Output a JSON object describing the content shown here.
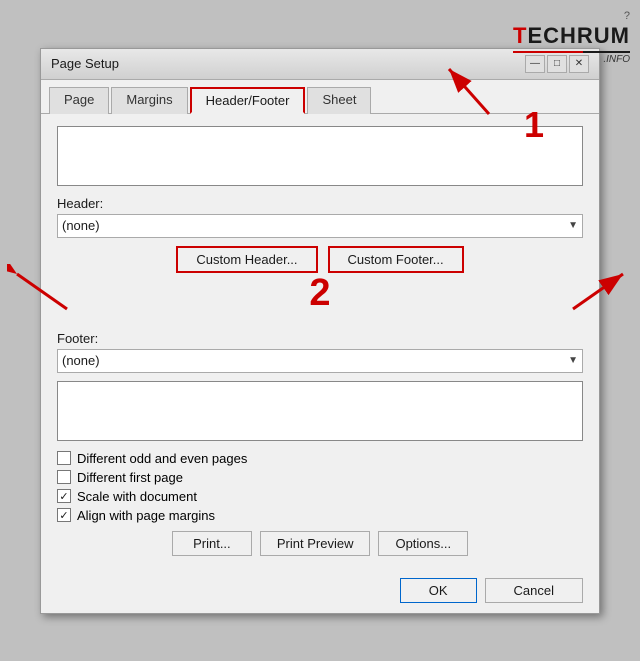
{
  "watermark": {
    "question_mark": "?",
    "brand": "TECHRUM",
    "sub": ".INFO"
  },
  "dialog": {
    "title": "Page Setup",
    "titlebar_controls": [
      "—",
      "□",
      "✕"
    ],
    "tabs": [
      {
        "label": "Page",
        "active": false
      },
      {
        "label": "Margins",
        "active": false
      },
      {
        "label": "Header/Footer",
        "active": true
      },
      {
        "label": "Sheet",
        "active": false
      }
    ],
    "header_label": "Header:",
    "header_value": "(none)",
    "custom_header_btn": "Custom Header...",
    "custom_footer_btn": "Custom Footer...",
    "footer_label": "Footer:",
    "footer_value": "(none)",
    "annotation_1": "1",
    "annotation_2": "2",
    "checkboxes": [
      {
        "label": "Different odd and even pages",
        "checked": false
      },
      {
        "label": "Different first page",
        "checked": false
      },
      {
        "label": "Scale with document",
        "checked": true
      },
      {
        "label": "Align with page margins",
        "checked": true
      }
    ],
    "bottom_buttons": [
      {
        "label": "Print..."
      },
      {
        "label": "Print Preview"
      },
      {
        "label": "Options..."
      }
    ],
    "ok_label": "OK",
    "cancel_label": "Cancel"
  }
}
